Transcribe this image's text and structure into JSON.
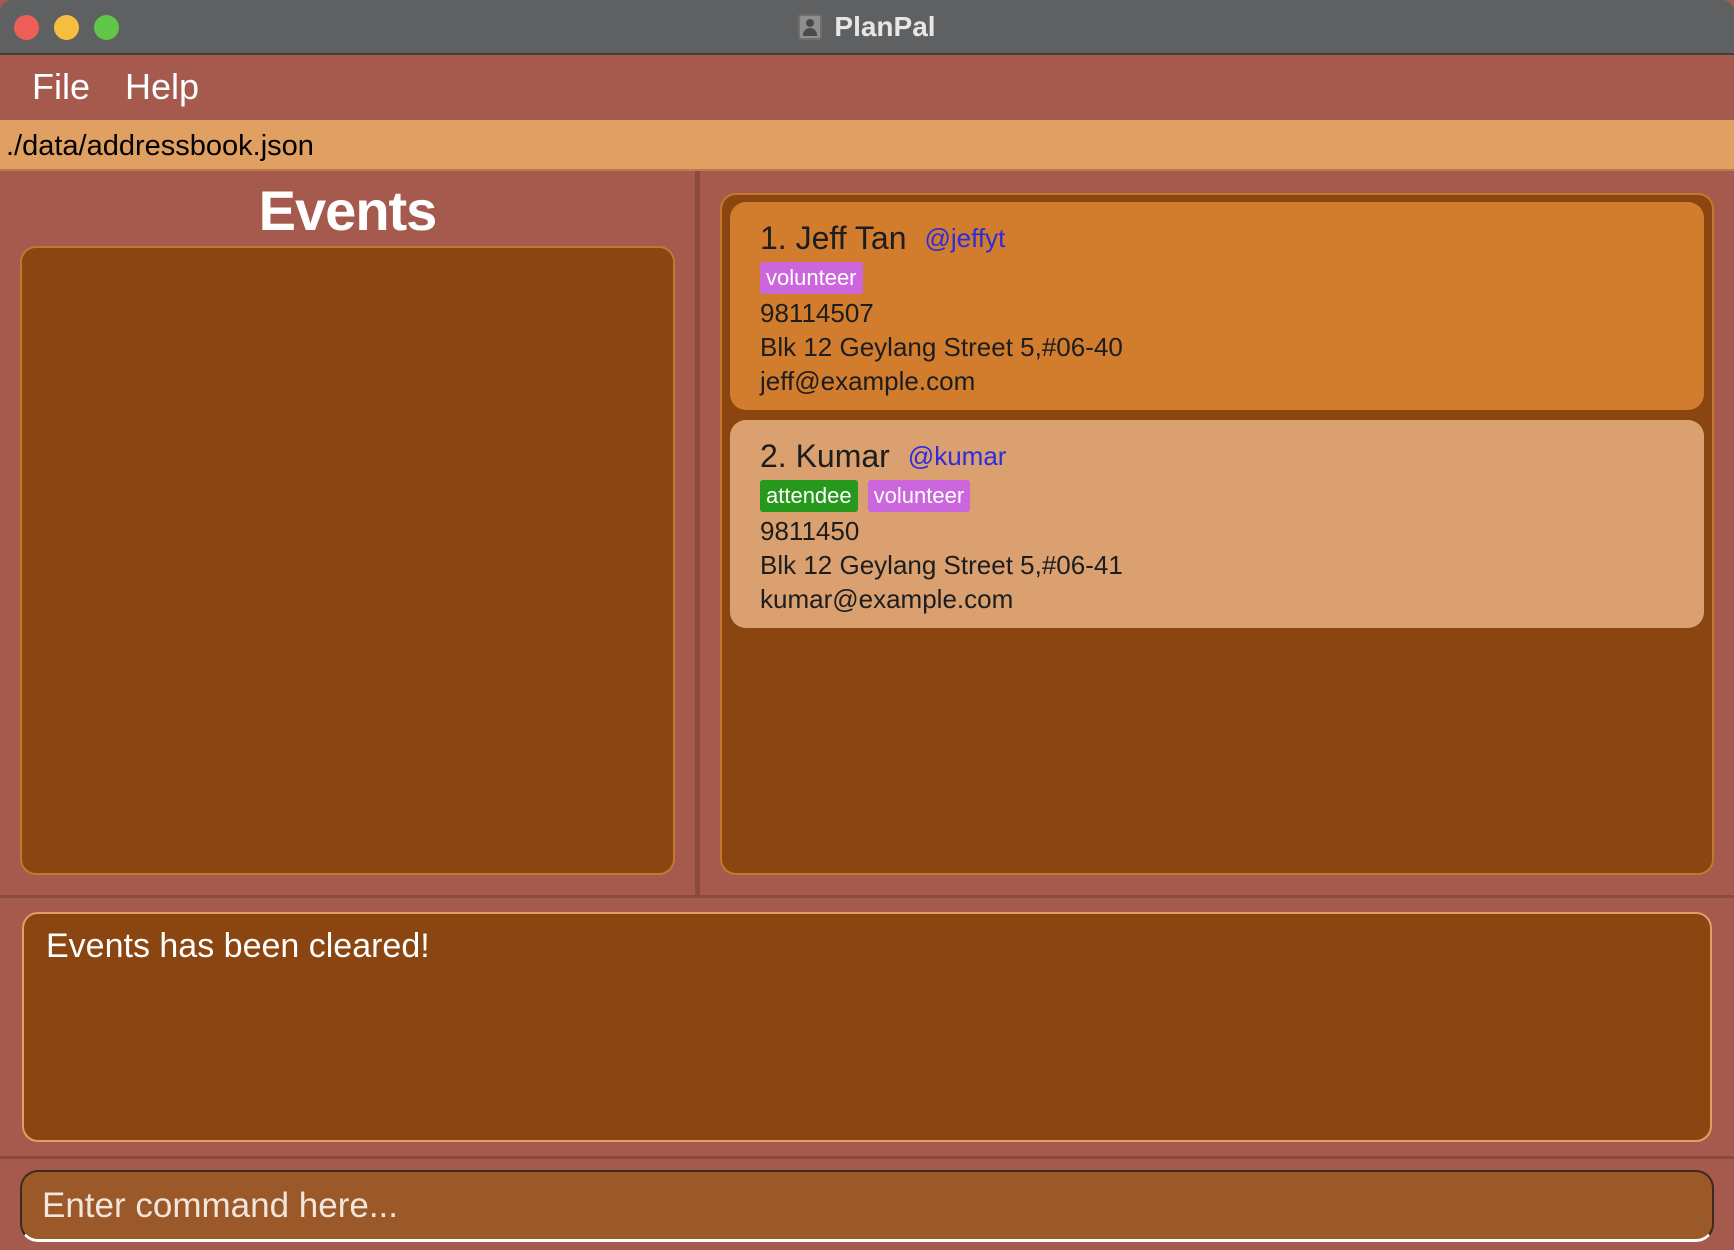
{
  "window": {
    "title": "PlanPal"
  },
  "menu": {
    "items": [
      {
        "label": "File"
      },
      {
        "label": "Help"
      }
    ]
  },
  "status_path": "./data/addressbook.json",
  "events_panel": {
    "title": "Events"
  },
  "persons": [
    {
      "index_name": "1. Jeff Tan",
      "handle": "@jeffyt",
      "tags": [
        "volunteer"
      ],
      "phone": "98114507",
      "address": "Blk 12 Geylang Street 5,#06-40",
      "email": "jeff@example.com"
    },
    {
      "index_name": "2. Kumar",
      "handle": "@kumar",
      "tags": [
        "attendee",
        "volunteer"
      ],
      "phone": "9811450",
      "address": "Blk 12 Geylang Street 5,#06-41",
      "email": "kumar@example.com"
    }
  ],
  "result_message": "Events has been cleared!",
  "command": {
    "value": "",
    "placeholder": "Enter command here..."
  },
  "colors": {
    "background": "#a65a4e",
    "panel": "#8a4510",
    "card_selected": "#d27c2e",
    "card": "#daa06f",
    "path_bar": "#e0a062",
    "tag_volunteer": "#cc66dd",
    "tag_attendee": "#26991c",
    "handle": "#2c2cdd"
  }
}
